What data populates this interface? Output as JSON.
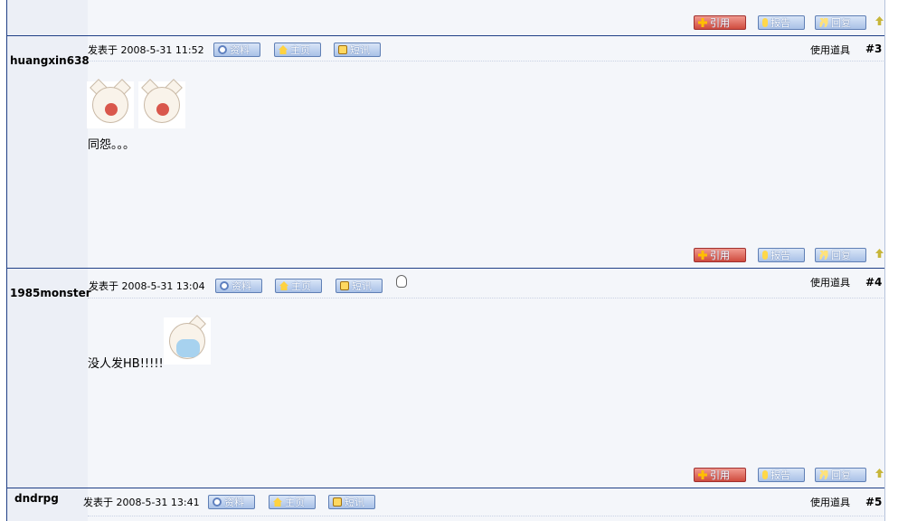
{
  "buttons": {
    "profile": "资料",
    "homepage": "主页",
    "message": "短讯",
    "quote": "引用",
    "report": "报告",
    "reply": "回复"
  },
  "use_tools": "使用道具",
  "posts": [
    {
      "username": "huangxin638",
      "posted": "发表于 2008-5-31 11:52",
      "floor": "#3",
      "text": "同怨。。。"
    },
    {
      "username": "1985monster",
      "posted": "发表于 2008-5-31 13:04",
      "floor": "#4",
      "text": "没人发HB!!!!!"
    },
    {
      "username": "dndrpg",
      "posted": "发表于 2008-5-31 13:41",
      "floor": "#5",
      "text": ""
    }
  ],
  "colors": {
    "border": "#1f3f86",
    "sidebar_bg": "#eceff6",
    "content_bg": "#f4f6fa",
    "button_blue": "#a9c1e7",
    "button_red": "#cf4b3e"
  },
  "icons": [
    "person-icon",
    "home-icon",
    "mail-icon",
    "plus-icon",
    "exclamation-icon",
    "quote-icon",
    "arrow-up-icon",
    "qq-penguin-icon"
  ]
}
